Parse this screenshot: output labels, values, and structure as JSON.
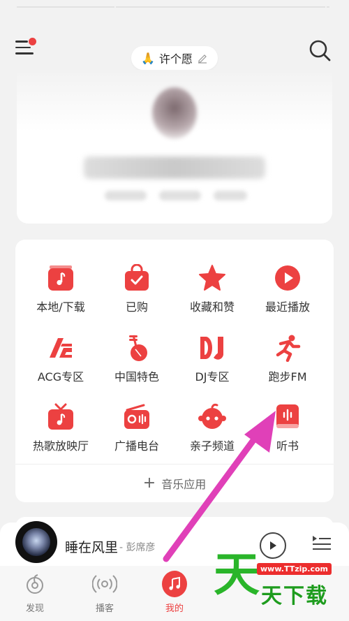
{
  "header": {
    "wish_label": "许个愿",
    "wish_icon": "praying-hands-icon",
    "notification_color": "#ec4141"
  },
  "grid": {
    "items": [
      {
        "label": "本地/下载",
        "icon": "music-note-folder-icon"
      },
      {
        "label": "已购",
        "icon": "shopping-bag-check-icon"
      },
      {
        "label": "收藏和赞",
        "icon": "star-icon"
      },
      {
        "label": "最近播放",
        "icon": "play-circle-icon"
      },
      {
        "label": "ACG专区",
        "icon": "acg-logo-icon"
      },
      {
        "label": "中国特色",
        "icon": "pipa-instrument-icon"
      },
      {
        "label": "DJ专区",
        "icon": "dj-logo-icon"
      },
      {
        "label": "跑步FM",
        "icon": "running-person-icon"
      },
      {
        "label": "热歌放映厅",
        "icon": "tv-music-icon"
      },
      {
        "label": "广播电台",
        "icon": "radio-icon"
      },
      {
        "label": "亲子频道",
        "icon": "kid-face-icon"
      },
      {
        "label": "听书",
        "icon": "audiobook-icon"
      }
    ],
    "music_app_label": "音乐应用",
    "accent": "#ec4141"
  },
  "player": {
    "song_title": "睡在风里",
    "song_artist": "- 彭席彦"
  },
  "tabs": [
    {
      "label": "发现",
      "icon": "discover-icon"
    },
    {
      "label": "播客",
      "icon": "podcast-icon"
    },
    {
      "label": "我的",
      "icon": "music-note-icon"
    }
  ],
  "watermark": {
    "big_char": "天",
    "url": "www.TTzip.com",
    "small_text": "天下载"
  }
}
